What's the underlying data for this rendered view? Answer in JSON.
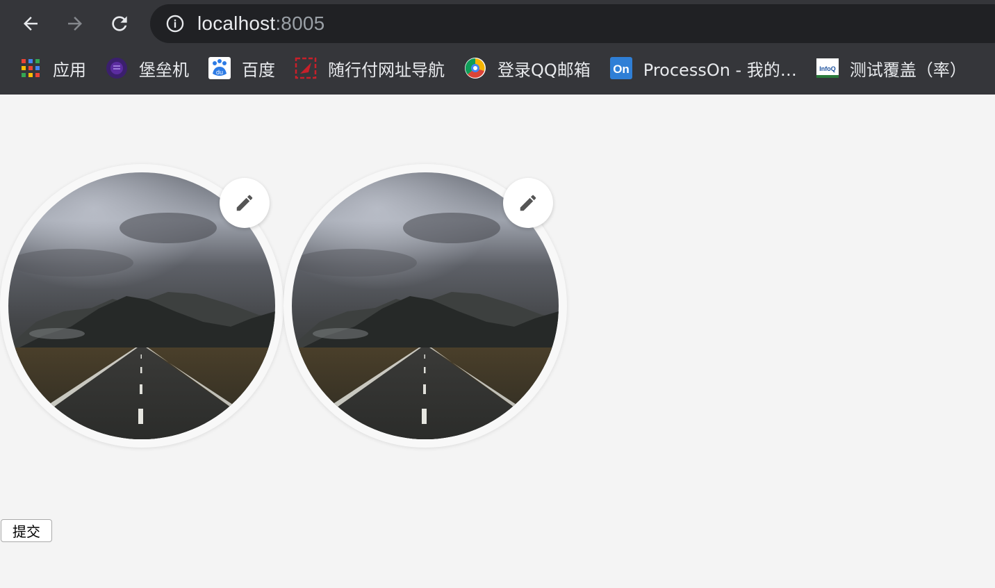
{
  "browser": {
    "url_host": "localhost",
    "url_port": ":8005",
    "colors": {
      "chrome_bg": "#35363a",
      "omnibox_bg": "#202124",
      "text": "#e8eaed",
      "muted": "#9aa0a6"
    },
    "nav": {
      "back_icon": "arrow-left-icon",
      "forward_icon": "arrow-right-icon",
      "reload_icon": "reload-icon",
      "site_info_icon": "info-icon"
    },
    "bookmarks": [
      {
        "label": "应用",
        "icon": "apps-grid-icon"
      },
      {
        "label": "堡垒机",
        "icon": "bastion-icon"
      },
      {
        "label": "百度",
        "icon": "baidu-icon"
      },
      {
        "label": "随行付网址导航",
        "icon": "vbill-icon"
      },
      {
        "label": "登录QQ邮箱",
        "icon": "qqmail-icon"
      },
      {
        "label": "ProcessOn - 我的…",
        "icon": "processon-icon"
      },
      {
        "label": "测试覆盖（率）",
        "icon": "infoq-icon"
      }
    ]
  },
  "page": {
    "background": "#f4f4f4",
    "avatars": [
      {
        "image": "road-mountain-photo",
        "edit_icon": "pencil-icon"
      },
      {
        "image": "road-mountain-photo",
        "edit_icon": "pencil-icon"
      }
    ],
    "submit_label": "提交"
  }
}
